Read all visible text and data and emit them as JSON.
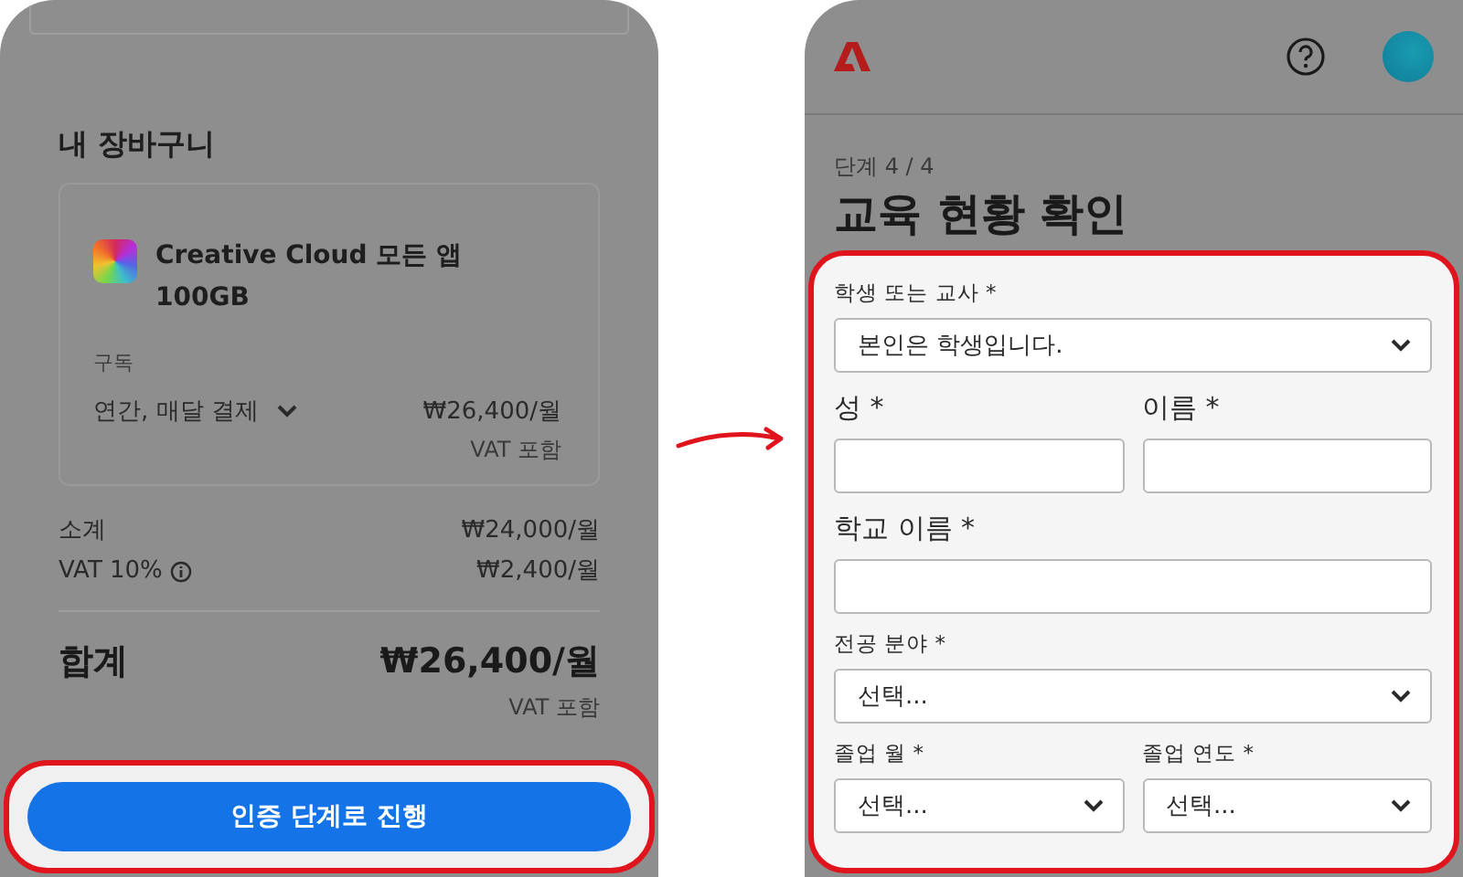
{
  "cart_screen": {
    "heading": "내 장바구니",
    "product": {
      "name": "Creative Cloud 모든 앱",
      "storage": "100GB",
      "plan_label": "구독",
      "plan": "연간, 매달 결제",
      "price": "₩26,400/월",
      "price_note": "VAT 포함"
    },
    "summary": [
      {
        "label": "소계",
        "value": "₩24,000/월",
        "info": false
      },
      {
        "label": "VAT 10%",
        "value": "₩2,400/월",
        "info": true
      }
    ],
    "total": {
      "label": "합계",
      "value": "₩26,400/월",
      "note": "VAT 포함"
    },
    "continue_button": "인증 단계로 진행"
  },
  "form_screen": {
    "step": "단계 4 / 4",
    "title": "교육 현황 확인",
    "rows": [
      [
        {
          "kind": "select",
          "label": "학생 또는 교사 *",
          "value": "본인은 학생입니다."
        }
      ],
      [
        {
          "kind": "text",
          "label": "성 *"
        },
        {
          "kind": "text",
          "label": "이름 *"
        }
      ],
      [
        {
          "kind": "text",
          "label": "학교 이름 *"
        }
      ],
      [
        {
          "kind": "select",
          "label": "전공 분야 *",
          "value": "선택..."
        }
      ],
      [
        {
          "kind": "select",
          "label": "졸업 월 *",
          "value": "선택..."
        },
        {
          "kind": "select",
          "label": "졸업 연도 *",
          "value": "선택..."
        }
      ]
    ]
  }
}
